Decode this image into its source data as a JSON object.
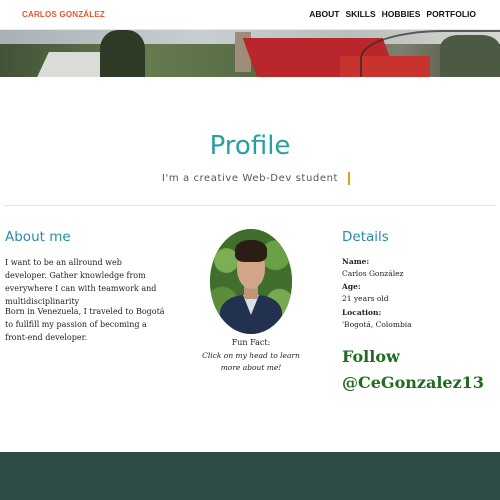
{
  "nav": {
    "brand": "CARLOS GONZÁLEZ",
    "brand_color": "#e4572e",
    "items": [
      {
        "label": "ABOUT"
      },
      {
        "label": "SKILLS"
      },
      {
        "label": "HOBBIES"
      },
      {
        "label": "PORTFOLIO"
      }
    ]
  },
  "profile": {
    "title": "Profile",
    "subtitle": "I'm a creative Web-Dev student"
  },
  "about": {
    "heading": "About me",
    "paragraph1": "I want to be an allround web developer. Gather knowledge from everywhere I can with teamwork and multidisciplinarity",
    "paragraph2": "Born in Venezuela, I traveled to Bogotá to fullfill my passion of becoming a front-end developer."
  },
  "fun_fact": {
    "label": "Fun Fact:",
    "text": "Click on my head to learn more about me!"
  },
  "details": {
    "heading": "Details",
    "name_label": "Name:",
    "name_value": "Carlos González",
    "age_label": "Age:",
    "age_value": "21 years old",
    "location_label": "Location:",
    "location_value": "'Bogotá, Colombia"
  },
  "follow": {
    "line1": "Follow",
    "line2": "@CeGonzalez13"
  },
  "colors": {
    "accent": "#26a0a0",
    "heading": "#2a8ca8",
    "follow": "#1f6b1f",
    "footer": "#2f4c48"
  }
}
